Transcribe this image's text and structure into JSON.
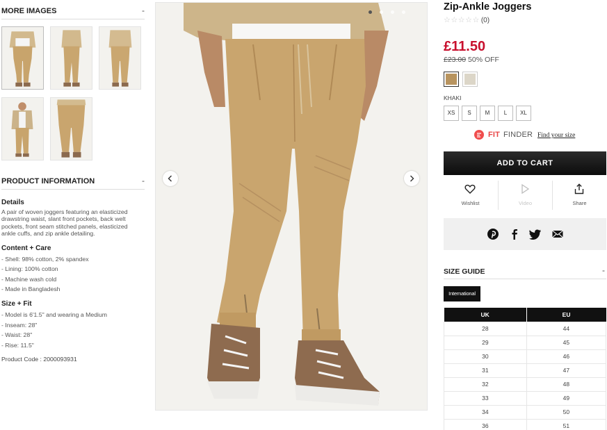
{
  "more_images": {
    "title": "MORE IMAGES",
    "toggle": "-",
    "thumbnails": [
      {
        "view": "front",
        "selected": true
      },
      {
        "view": "side-left",
        "selected": false
      },
      {
        "view": "back",
        "selected": false
      },
      {
        "view": "full-outfit",
        "selected": false
      },
      {
        "view": "detail",
        "selected": false
      }
    ]
  },
  "product_information": {
    "title": "PRODUCT INFORMATION",
    "toggle": "-",
    "details_heading": "Details",
    "description": "A pair of woven joggers featuring an elasticized drawstring waist, slant front pockets, back welt pockets, front seam stitched panels, elasticized ankle cuffs, and zip ankle detailing.",
    "content_heading": "Content + Care",
    "content_items": [
      "- Shell: 98% cotton, 2% spandex",
      "- Lining: 100% cotton",
      "- Machine wash cold",
      "- Made in Bangladesh"
    ],
    "size_heading": "Size + Fit",
    "size_items": [
      "- Model is 6'1.5\" and wearing a Medium",
      "- Inseam: 28\"",
      "- Waist: 28\"",
      "- Rise: 11.5\""
    ],
    "product_code": "Product Code : 2000093931"
  },
  "gallery": {
    "dots": 4,
    "active_dot": 0,
    "prev_icon": "chevron-left-icon",
    "next_icon": "chevron-right-icon"
  },
  "product": {
    "title": "Zip-Ankle Joggers",
    "stars": "☆☆☆☆☆",
    "review_count": "(0)",
    "price": "£11.50",
    "old_price": "£23.00",
    "discount": "50% OFF",
    "colors": [
      {
        "name": "KHAKI",
        "hex": "#b8945f",
        "selected": true
      },
      {
        "name": "CREAM",
        "hex": "#dcd6c8",
        "selected": false
      }
    ],
    "selected_color": "KHAKI",
    "sizes": [
      "XS",
      "S",
      "M",
      "L",
      "XL"
    ],
    "fit_finder": {
      "fit": "FIT",
      "finder": "FINDER",
      "link": "Find your size"
    },
    "add_to_cart": "ADD TO CART",
    "actions": [
      {
        "label": "Wishlist",
        "icon": "heart-icon",
        "enabled": true
      },
      {
        "label": "Video",
        "icon": "play-icon",
        "enabled": false
      },
      {
        "label": "Share",
        "icon": "share-icon",
        "enabled": true
      }
    ],
    "share_icons": [
      "pinterest-icon",
      "facebook-icon",
      "twitter-icon",
      "email-icon"
    ]
  },
  "size_guide": {
    "title": "SIZE GUIDE",
    "toggle": "-",
    "region_button": "International",
    "columns": [
      "UK",
      "EU"
    ],
    "rows": [
      [
        "28",
        "44"
      ],
      [
        "29",
        "45"
      ],
      [
        "30",
        "46"
      ],
      [
        "31",
        "47"
      ],
      [
        "32",
        "48"
      ],
      [
        "33",
        "49"
      ],
      [
        "34",
        "50"
      ],
      [
        "36",
        "51"
      ]
    ]
  },
  "colors": {
    "accent_red": "#c8102e",
    "fit_finder_red": "#e84545",
    "button_black": "#111111"
  }
}
